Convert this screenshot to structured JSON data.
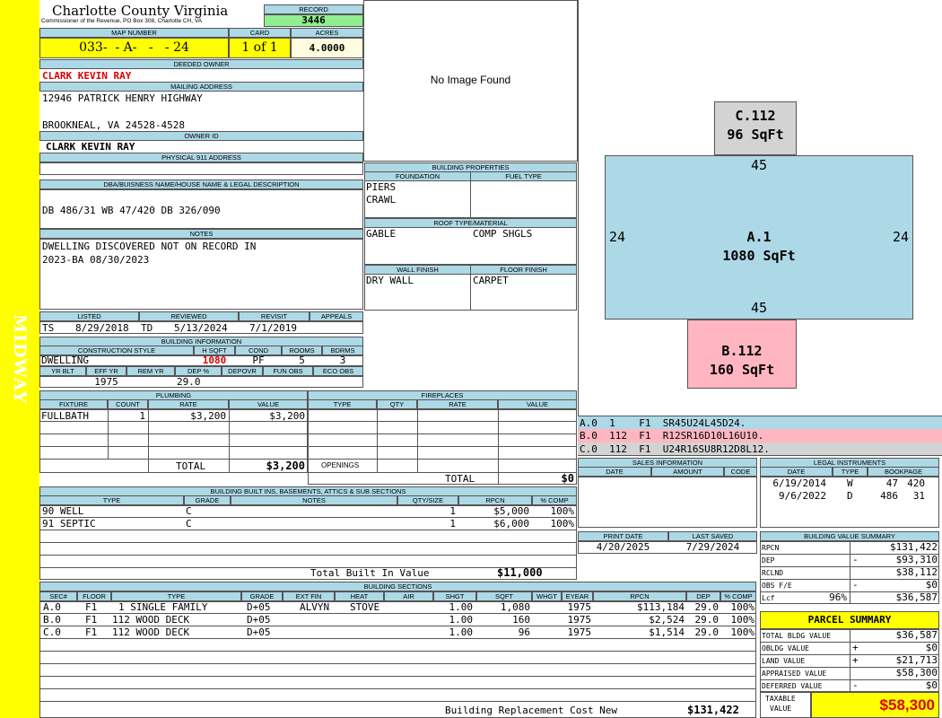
{
  "side_label": "MIDWAY",
  "header": {
    "county": "Charlotte County Virginia",
    "commissioner": "Commissioner of the Revenue, PO Box 308, Charlotte CH, VA",
    "record_label": "RECORD",
    "record": "3446",
    "map_label": "MAP NUMBER",
    "map_number": "033-  - A-   -   - 24",
    "card_label": "CARD",
    "card": "1 of 1",
    "acres_label": "ACRES",
    "acres": "4.0000"
  },
  "owner": {
    "deeded_label": "DEEDED OWNER",
    "deeded": "CLARK KEVIN RAY",
    "mailing_label": "MAILING ADDRESS",
    "addr1": "12946 PATRICK HENRY HIGHWAY",
    "addr2": "BROOKNEAL, VA 24528-4528",
    "owner_id_label": "OWNER ID",
    "owner_id": "CLARK KEVIN RAY",
    "physical_label": "PHYSICAL 911 ADDRESS",
    "physical": ""
  },
  "legal": {
    "label": "DBA/BUISNESS NAME/HOUSE NAME & LEGAL DESCRIPTION",
    "text": "DB 486/31 WB 47/420 DB 326/090"
  },
  "notes": {
    "label": "NOTES",
    "line1": "DWELLING DISCOVERED NOT ON RECORD IN",
    "line2": "2023-BA 08/30/2023"
  },
  "photo": {
    "text": "No Image Found"
  },
  "building_properties": {
    "label": "BUILDING PROPERTIES",
    "foundation_label": "FOUNDATION",
    "fuel_label": "FUEL TYPE",
    "foundation1": "PIERS",
    "foundation2": "CRAWL",
    "roof_label": "ROOF TYPE/MATERIAL",
    "roof_type": "GABLE",
    "roof_material": "COMP SHGLS",
    "wall_label": "WALL FINISH",
    "floor_label": "FLOOR FINISH",
    "wall": "DRY WALL",
    "floor": "CARPET"
  },
  "dates": {
    "listed_label": "LISTED",
    "reviewed_label": "REVIEWED",
    "revisit_label": "REVISIT",
    "appeals_label": "APPEALS",
    "listed_code": "TS",
    "listed": "8/29/2018",
    "reviewed_code": "TD",
    "reviewed": "5/13/2024",
    "revisit": "7/1/2019",
    "appeals": ""
  },
  "building_info": {
    "label": "BUILDING INFORMATION",
    "style_label": "CONSTRUCTION STYLE",
    "hsqft_label": "H SQFT",
    "cond_label": "COND",
    "rooms_label": "ROOMS",
    "bdrms_label": "BDRMS",
    "style": "DWELLING",
    "hsqft": "1080",
    "cond": "PF",
    "rooms": "5",
    "bdrms": "3",
    "yrblt_label": "YR BLT",
    "effyr_label": "EFF YR",
    "remyr_label": "REM YR",
    "dep_label": "DEP %",
    "depovr_label": "DEPOVR",
    "funobs_label": "FUN OBS",
    "ecoobs_label": "ECO OBS",
    "yrblt": "",
    "effyr": "1975",
    "remyr": "",
    "dep": "29.0",
    "depovr": "",
    "funobs": "",
    "ecoobs": ""
  },
  "plumbing": {
    "label": "PLUMBING",
    "cols": [
      "FIXTURE",
      "COUNT",
      "RATE",
      "VALUE"
    ],
    "rows": [
      {
        "fixture": "FULLBATH",
        "count": "1",
        "rate": "$3,200",
        "value": "$3,200"
      }
    ],
    "total_label": "TOTAL",
    "total": "$3,200"
  },
  "fireplaces": {
    "label": "FIREPLACES",
    "cols": [
      "TYPE",
      "QTY",
      "RATE",
      "VALUE"
    ],
    "openings_label": "OPENINGS",
    "total_label": "TOTAL",
    "total": "$0"
  },
  "builtins": {
    "label": "BUILDING BUILT INS, BASEMENTS, ATTICS & SUB SECTIONS",
    "cols": [
      "TYPE",
      "GRADE",
      "NOTES",
      "QTY/SIZE",
      "RPCN",
      "% COMP"
    ],
    "rows": [
      {
        "type": "90 WELL",
        "grade": "C",
        "notes": "",
        "qty": "1",
        "rpcn": "$5,000",
        "comp": "100%"
      },
      {
        "type": "91 SEPTIC",
        "grade": "C",
        "notes": "",
        "qty": "1",
        "rpcn": "$6,000",
        "comp": "100%"
      }
    ],
    "total_label": "Total Built In Value",
    "total": "$11,000"
  },
  "sections": {
    "label": "BUILDING SECTIONS",
    "cols": [
      "SEC#",
      "FLOOR",
      "TYPE",
      "GRADE",
      "EXT FIN",
      "HEAT",
      "AIR",
      "SHGT",
      "SQFT",
      "WHGT",
      "EYEAR",
      "RPCN",
      "DEP",
      "% COMP"
    ],
    "rows": [
      {
        "sec": "A.0",
        "floor": "F1",
        "type": "1 SINGLE FAMILY",
        "grade": "D+05",
        "ext": "ALVYN",
        "heat": "STOVE",
        "air": "",
        "shgt": "1.00",
        "sqft": "1,080",
        "whgt": "",
        "eyear": "1975",
        "rpcn": "$113,184",
        "dep": "29.0",
        "comp": "100%"
      },
      {
        "sec": "B.0",
        "floor": "F1",
        "type": "112 WOOD DECK",
        "grade": "D+05",
        "ext": "",
        "heat": "",
        "air": "",
        "shgt": "1.00",
        "sqft": "160",
        "whgt": "",
        "eyear": "1975",
        "rpcn": "$2,524",
        "dep": "29.0",
        "comp": "100%"
      },
      {
        "sec": "C.0",
        "floor": "F1",
        "type": "112 WOOD DECK",
        "grade": "D+05",
        "ext": "",
        "heat": "",
        "air": "",
        "shgt": "1.00",
        "sqft": "96",
        "whgt": "",
        "eyear": "1975",
        "rpcn": "$1,514",
        "dep": "29.0",
        "comp": "100%"
      }
    ],
    "total_label": "Building Replacement Cost New",
    "total": "$131,422"
  },
  "sketch": {
    "c_label": "C.112",
    "c_area": "96 SqFt",
    "a_label": "A.1",
    "a_area": "1080 SqFt",
    "b_label": "B.112",
    "b_area": "160 SqFt",
    "dim_top": "45",
    "dim_bottom": "45",
    "dim_left": "24",
    "dim_right": "24",
    "colors": {
      "a": "#add8e6",
      "b": "#ffb6c1",
      "c": "#d3d3d3"
    },
    "legend": [
      {
        "text": "A.0  1    F1  SR45U24L45D24.",
        "color": "#add8e6"
      },
      {
        "text": "B.0  112  F1  R12SR16D10L16U10.",
        "color": "#ffb6c1"
      },
      {
        "text": "C.0  112  F1  U24R16SU8R12D8L12.",
        "color": "#d3d3d3"
      }
    ]
  },
  "sales": {
    "label": "SALES INFORMATION",
    "cols": [
      "DATE",
      "AMOUNT",
      "CODE"
    ]
  },
  "legal_instruments": {
    "label": "LEGAL INSTRUMENTS",
    "cols": [
      "DATE",
      "TYPE",
      "BOOKPAGE"
    ],
    "rows": [
      {
        "date": "6/19/2014",
        "type": "W",
        "book": "47",
        "page": "420"
      },
      {
        "date": "9/6/2022",
        "type": "D",
        "book": "486",
        "page": "31"
      }
    ]
  },
  "print": {
    "print_label": "PRINT DATE",
    "saved_label": "LAST SAVED",
    "print_date": "4/20/2025",
    "last_saved": "7/29/2024"
  },
  "value_summary": {
    "label": "BUILDING VALUE SUMMARY",
    "rpcn_label": "RPCN",
    "rpcn": "$131,422",
    "dep_label": "DEP",
    "dep_sign": "-",
    "dep": "$93,310",
    "rclnd_label": "RCLND",
    "rclnd": "$38,112",
    "obs_label": "OBS F/E",
    "obs_sign": "-",
    "obs": "$0",
    "lcf_label": "Lcf",
    "lcf_pct": "96%",
    "lcf": "$36,587"
  },
  "parcel": {
    "label": "PARCEL SUMMARY",
    "bldg_label": "TOTAL BLDG VALUE",
    "bldg": "$36,587",
    "obldg_label": "OBLDG VALUE",
    "obldg_sign": "+",
    "obldg": "$0",
    "land_label": "LAND VALUE",
    "land_sign": "+",
    "land": "$21,713",
    "appraised_label": "APPRAISED VALUE",
    "appraised": "$58,300",
    "deferred_label": "DEFERRED VALUE",
    "deferred_sign": "-",
    "deferred": "$0",
    "taxable_label1": "TAXABLE",
    "taxable_label2": "VALUE",
    "taxable": "$58,300"
  }
}
